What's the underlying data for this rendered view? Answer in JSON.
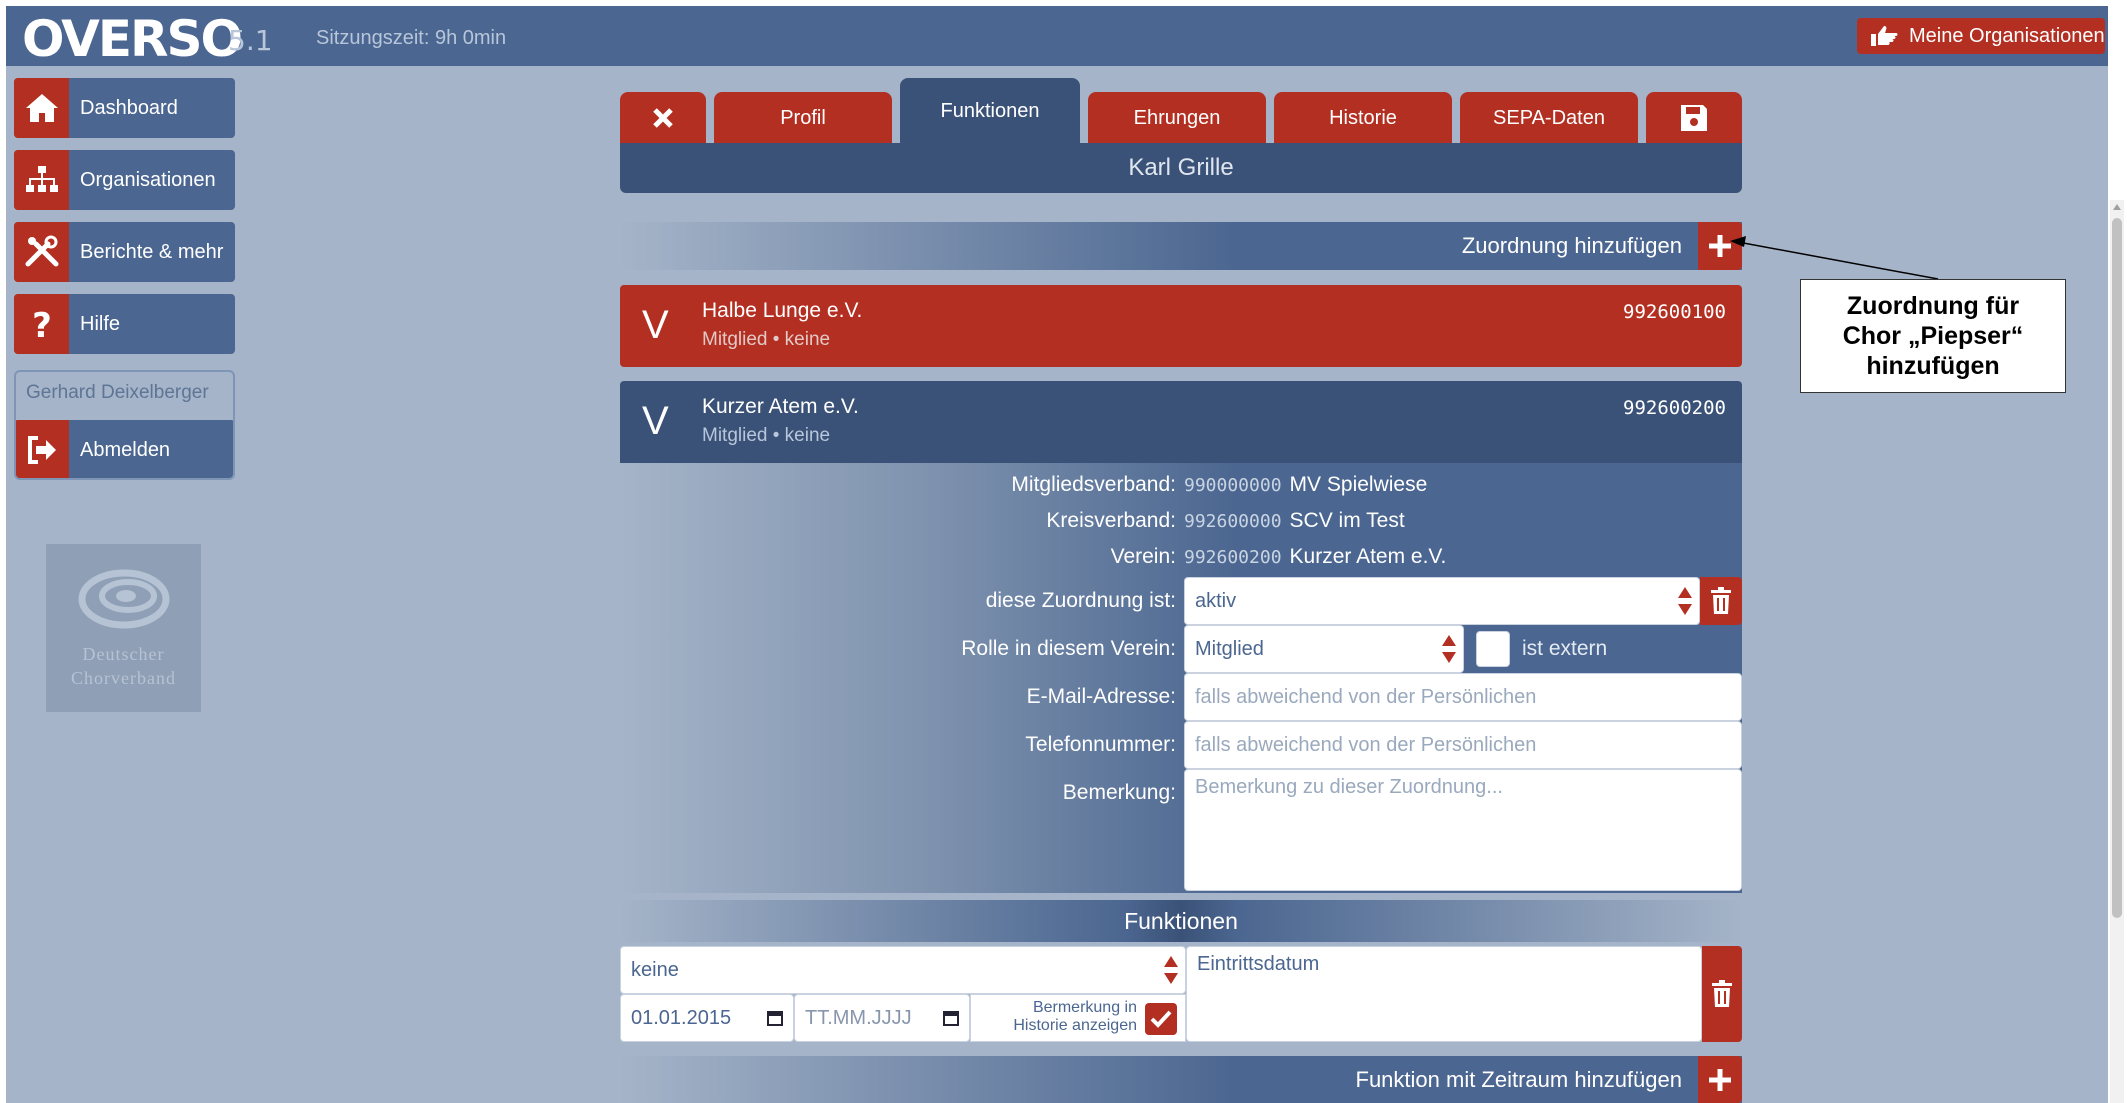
{
  "app": {
    "logo": "OVERSO",
    "version": "5.1",
    "session": "Sitzungszeit: 9h 0min",
    "my_orgs": "Meine Organisationen"
  },
  "sidebar": {
    "items": [
      {
        "label": "Dashboard",
        "icon": "home-icon"
      },
      {
        "label": "Organisationen",
        "icon": "sitemap-icon"
      },
      {
        "label": "Berichte & mehr",
        "icon": "tools-icon"
      },
      {
        "label": "Hilfe",
        "icon": "question-icon"
      }
    ],
    "user": "Gerhard Deixelberger",
    "logout": "Abmelden",
    "logo_line1": "Deutscher",
    "logo_line2": "Chorverband"
  },
  "tabs": [
    {
      "label": "Profil"
    },
    {
      "label": "Funktionen"
    },
    {
      "label": "Ehrungen"
    },
    {
      "label": "Historie"
    },
    {
      "label": "SEPA-Daten"
    }
  ],
  "person": "Karl Grille",
  "add_assignment": "Zuordnung hinzufügen",
  "orgs": [
    {
      "letter": "V",
      "name": "Halbe Lunge e.V.",
      "sub": "Mitglied • keine",
      "number": "992600100"
    },
    {
      "letter": "V",
      "name": "Kurzer Atem e.V.",
      "sub": "Mitglied • keine",
      "number": "992600200"
    }
  ],
  "details": {
    "mitgliedsverband_label": "Mitgliedsverband:",
    "mitgliedsverband_code": "990000000",
    "mitgliedsverband_name": "MV Spielwiese",
    "kreisverband_label": "Kreisverband:",
    "kreisverband_code": "992600000",
    "kreisverband_name": "SCV im Test",
    "verein_label": "Verein:",
    "verein_code": "992600200",
    "verein_name": "Kurzer Atem e.V.",
    "status_label": "diese Zuordnung ist:",
    "status_value": "aktiv",
    "role_label": "Rolle in diesem Verein:",
    "role_value": "Mitglied",
    "extern_label": "ist extern",
    "email_label": "E-Mail-Adresse:",
    "email_placeholder": "falls abweichend von der Persönlichen",
    "phone_label": "Telefonnummer:",
    "phone_placeholder": "falls abweichend von der Persönlichen",
    "note_label": "Bemerkung:",
    "note_placeholder": "Bemerkung zu dieser Zuordnung..."
  },
  "functions": {
    "title": "Funktionen",
    "function_value": "keine",
    "start_date": "01.01.2015",
    "end_placeholder": "TT.MM.JJJJ",
    "history_line1": "Bermerkung in",
    "history_line2": "Historie anzeigen",
    "entry_label": "Eintrittsdatum",
    "add_label": "Funktion mit Zeitraum hinzufügen"
  },
  "callout": {
    "line1": "Zuordnung für",
    "line2": "Chor „Piepser“",
    "line3": "hinzufügen"
  },
  "colors": {
    "accent_red": "#b32f22",
    "nav_blue": "#4b6690",
    "dark_blue": "#3b5278",
    "background": "#a5b4c8"
  }
}
